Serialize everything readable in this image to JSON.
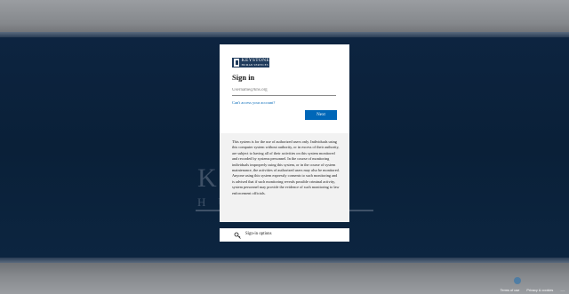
{
  "brand": {
    "logo_text_line1": "KEYSTONE",
    "logo_text_line2": "HUMAN SERVICES"
  },
  "card": {
    "title": "Sign in",
    "username_placeholder": "Username@khs.org",
    "cant_access_link": "Can't access your account?",
    "next_button": "Next"
  },
  "notice": {
    "text": "This system is for the use of authorized users only. Individuals using this computer system without authority, or in excess of their authority, are subject to having all of their activities on this system monitored and recorded by systems personnel. In the course of monitoring individuals improperly using this system, or in the course of system maintenance, the activities of authorized users may also be monitored. Anyone using this system expressly consents to such monitoring and is advised that if such monitoring reveals possible criminal activity, system personnel may provide the evidence of such monitoring to law enforcement officials."
  },
  "sign_in_options": {
    "label": "Sign-in options"
  },
  "footer": {
    "terms": "Terms of use",
    "privacy": "Privacy & cookies",
    "more": "..."
  },
  "colors": {
    "accent": "#0067b8",
    "band": "#0a2038",
    "logo_bg": "#1f3b5c"
  }
}
